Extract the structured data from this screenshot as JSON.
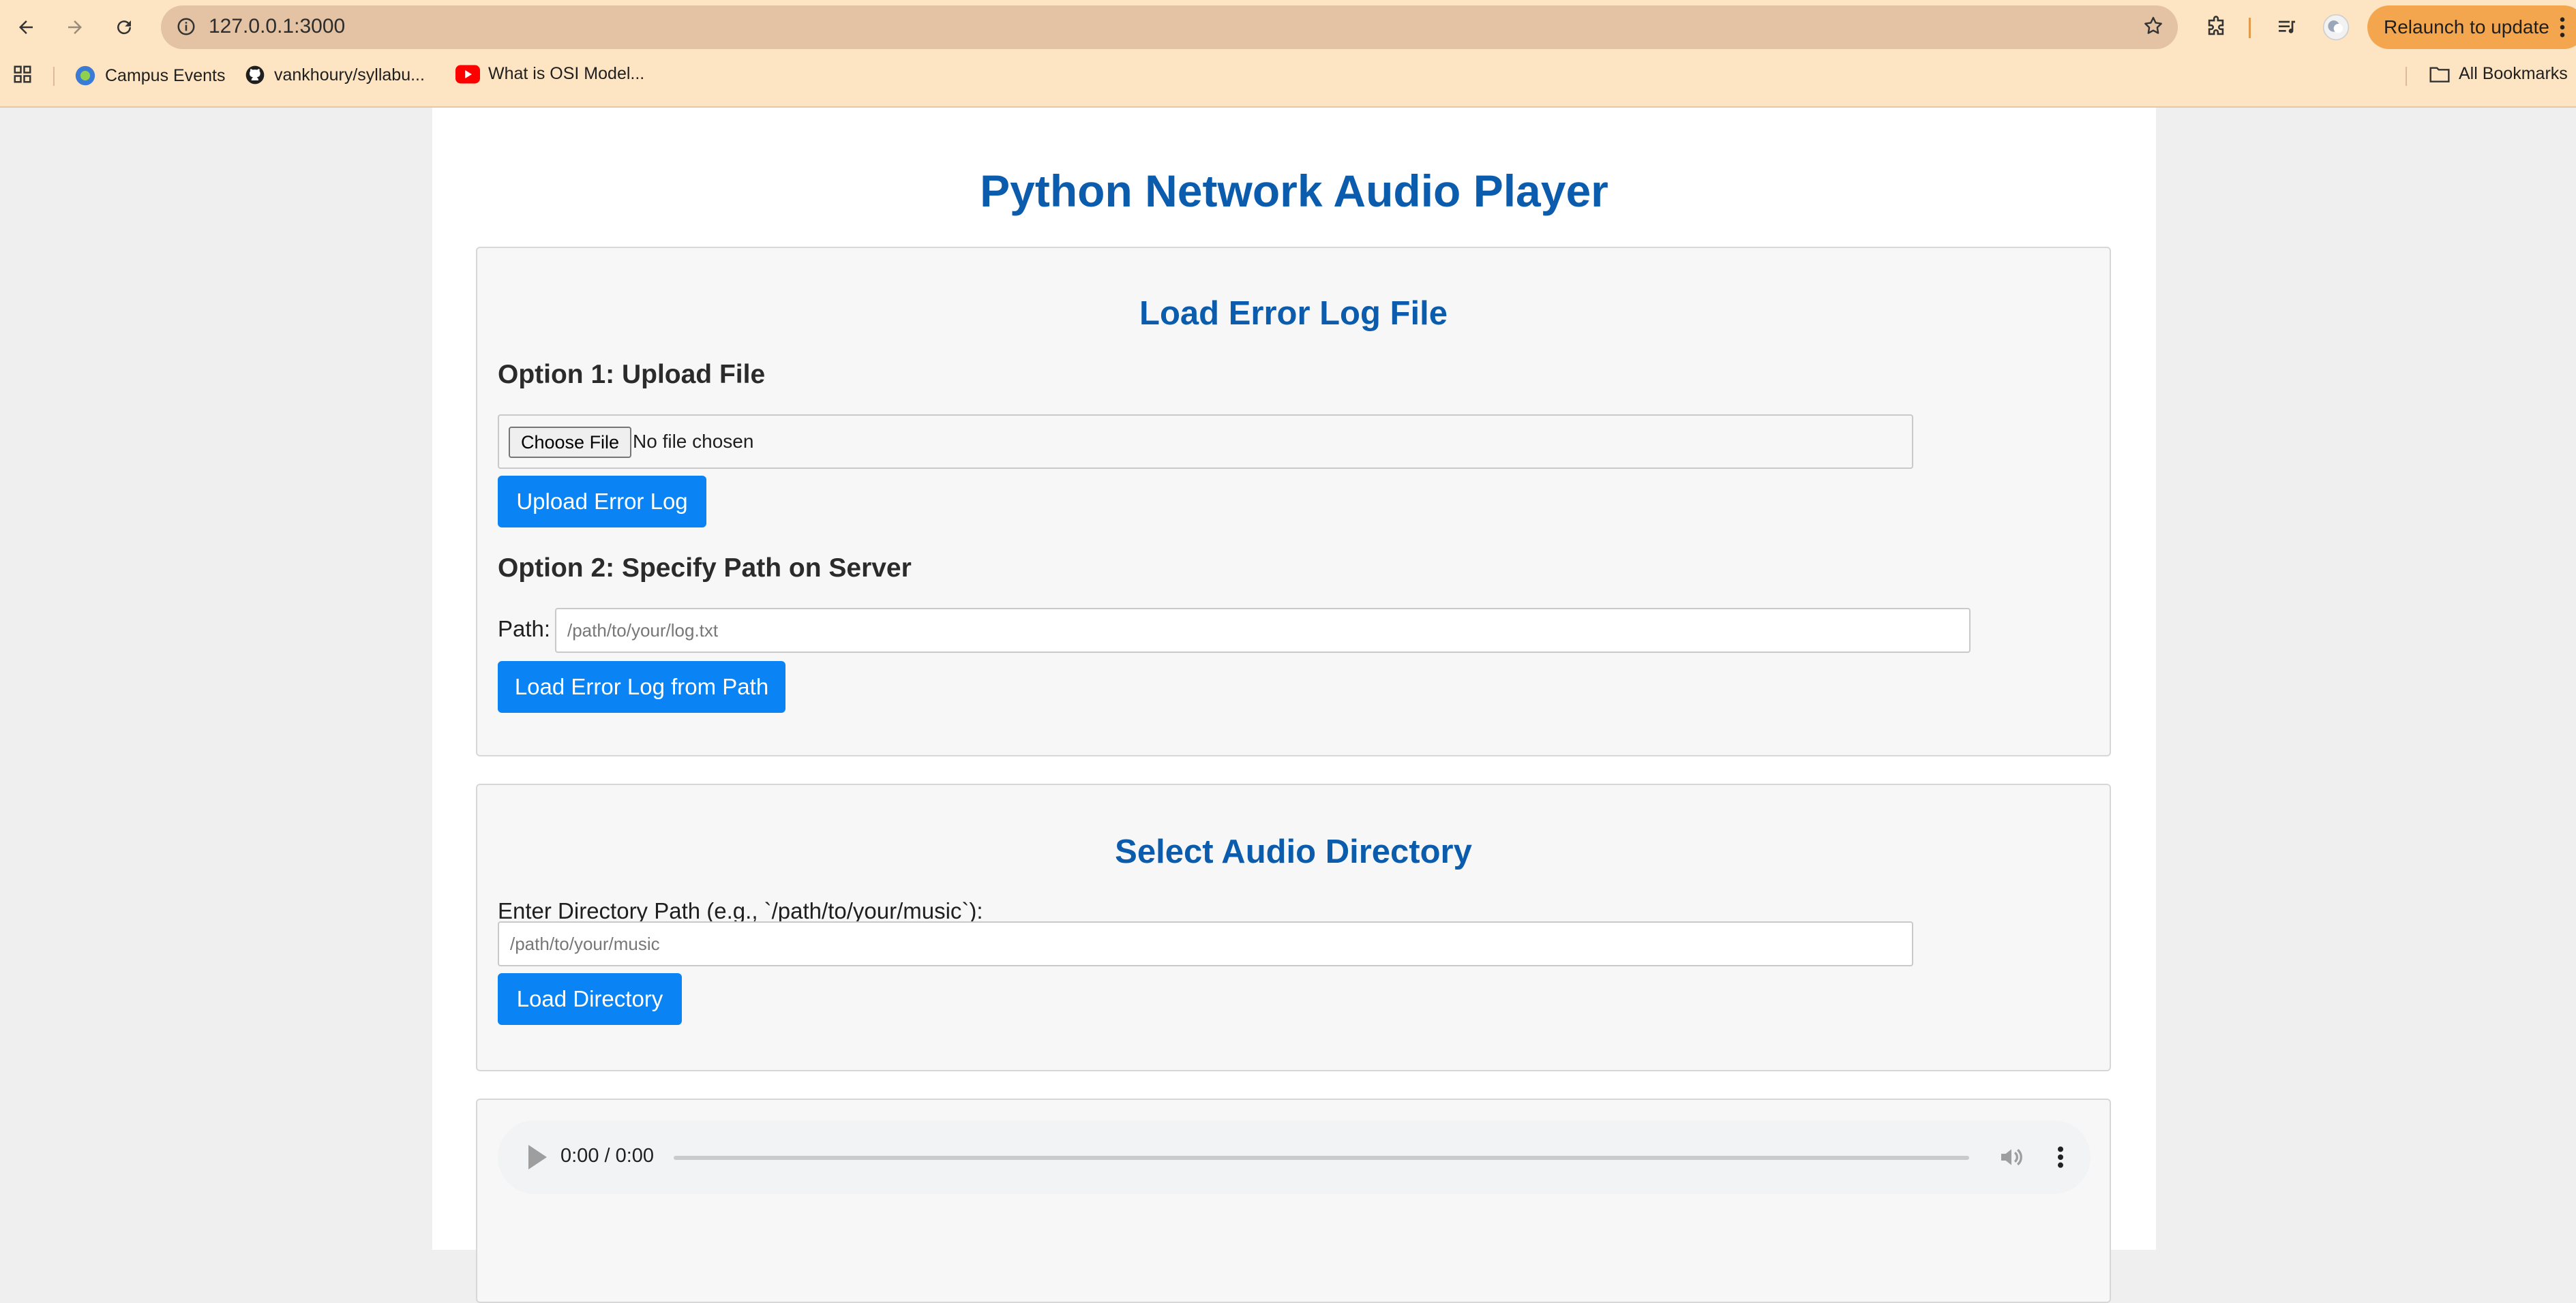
{
  "browser": {
    "url": "127.0.0.1:3000",
    "relaunch_label": "Relaunch to update",
    "bookmarks": [
      {
        "label": "Campus Events"
      },
      {
        "label": "vankhoury/syllabu..."
      },
      {
        "label": "What is OSI Model..."
      }
    ],
    "all_bookmarks_label": "All Bookmarks"
  },
  "page": {
    "title": "Python Network Audio Player",
    "error_log": {
      "heading": "Load Error Log File",
      "option1_heading": "Option 1: Upload File",
      "choose_file_label": "Choose File",
      "no_file_text": "No file chosen",
      "upload_button": "Upload Error Log",
      "option2_heading": "Option 2: Specify Path on Server",
      "path_label": "Path:",
      "path_placeholder": "/path/to/your/log.txt",
      "load_path_button": "Load Error Log from Path"
    },
    "audio_dir": {
      "heading": "Select Audio Directory",
      "prompt_label": "Enter Directory Path (e.g., `/path/to/your/music`):",
      "dir_placeholder": "/path/to/your/music",
      "load_button": "Load Directory"
    },
    "player": {
      "time": "0:00 / 0:00"
    }
  },
  "colors": {
    "heading_blue": "#0b5cad",
    "button_blue": "#0a84f5",
    "chrome_bg": "#fde4c2",
    "relaunch_bg": "#f4a64f"
  }
}
